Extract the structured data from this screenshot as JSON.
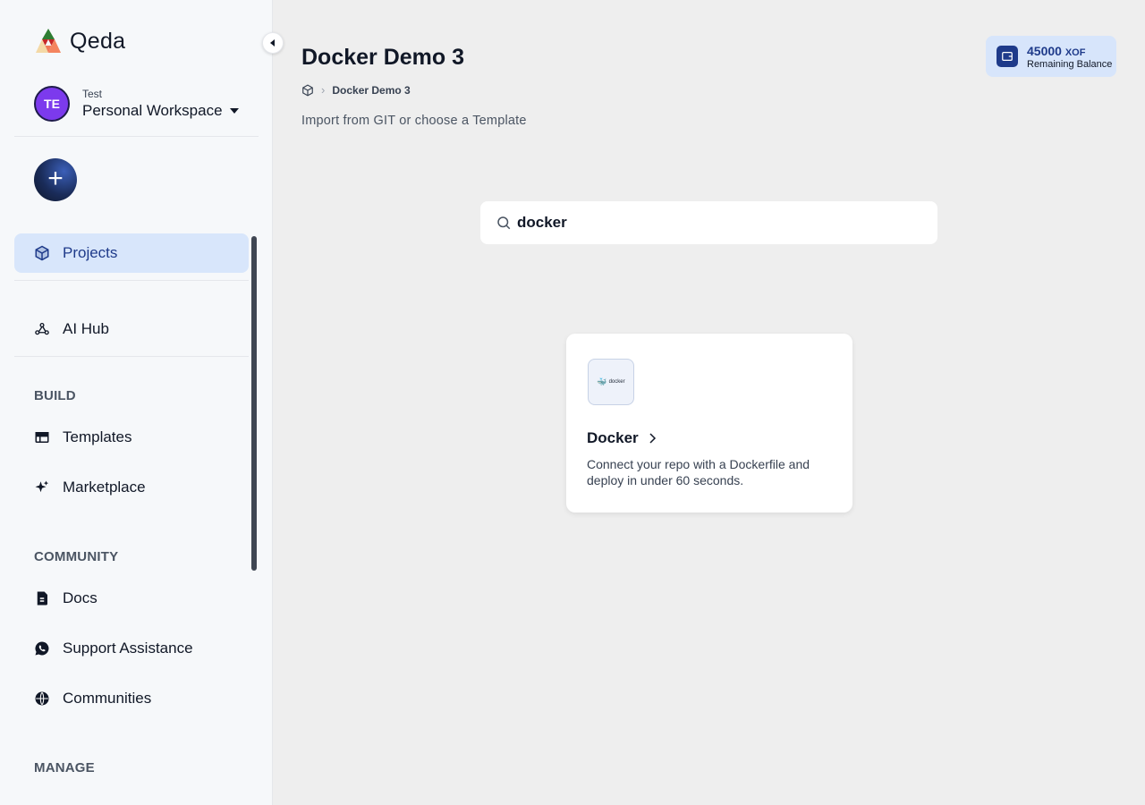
{
  "app": {
    "name": "Qeda"
  },
  "workspace": {
    "label": "Test",
    "name": "Personal Workspace",
    "initials": "TE"
  },
  "sidebar": {
    "add_label": "+",
    "primary": [
      {
        "label": "Projects",
        "icon": "cube-icon",
        "active": true
      },
      {
        "label": "AI Hub",
        "icon": "webhook-icon",
        "active": false
      }
    ],
    "sections": [
      {
        "title": "BUILD",
        "items": [
          {
            "label": "Templates",
            "icon": "table-icon"
          },
          {
            "label": "Marketplace",
            "icon": "sparkle-icon"
          }
        ]
      },
      {
        "title": "COMMUNITY",
        "items": [
          {
            "label": "Docs",
            "icon": "docs-icon"
          },
          {
            "label": "Support Assistance",
            "icon": "whatsapp-icon"
          },
          {
            "label": "Communities",
            "icon": "globe-icon"
          }
        ]
      },
      {
        "title": "MANAGE",
        "items": []
      }
    ]
  },
  "header": {
    "title": "Docker Demo 3",
    "breadcrumb": [
      {
        "icon": "cube-icon"
      },
      {
        "label": "Docker Demo 3"
      }
    ],
    "subtitle": "Import from GIT or choose a Template"
  },
  "balance": {
    "amount": "45000",
    "currency": "XOF",
    "label": "Remaining Balance"
  },
  "search": {
    "value": "docker",
    "placeholder": ""
  },
  "templates": [
    {
      "title": "Docker",
      "logo_text": "docker",
      "description": "Connect your repo with a Dockerfile and deploy in under 60 seconds."
    }
  ],
  "colors": {
    "accent": "#1e3a8a",
    "active_bg": "#d8e6fb",
    "avatar": "#7c3aed"
  }
}
